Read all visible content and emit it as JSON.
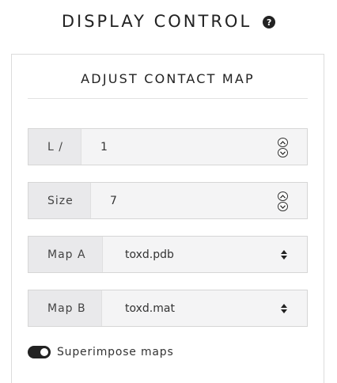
{
  "header": {
    "title": "DISPLAY CONTROL",
    "help_icon": "question-circle-icon"
  },
  "panel": {
    "title": "ADJUST CONTACT MAP",
    "rows": [
      {
        "label": "L /",
        "value": "1",
        "kind": "number"
      },
      {
        "label": "Size",
        "value": "7",
        "kind": "number"
      },
      {
        "label": "Map A",
        "value": "toxd.pdb",
        "kind": "select"
      },
      {
        "label": "Map B",
        "value": "toxd.mat",
        "kind": "select"
      }
    ],
    "toggle": {
      "label": "Superimpose maps",
      "on": true
    }
  }
}
